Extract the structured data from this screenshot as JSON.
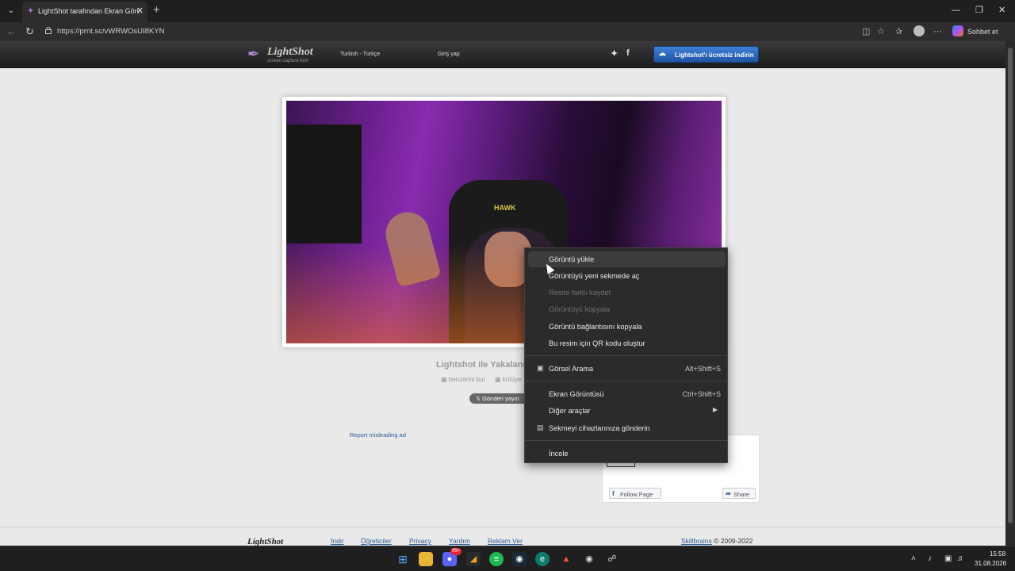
{
  "browser": {
    "tab_title": "LightShot tarafından Ekran Görüntüsü",
    "url": "https://prnt.sc/vWRWOsUI8KYN",
    "copilot_label": "Sohbet et",
    "icons": [
      "tab-list-icon",
      "new-tab-icon",
      "back-icon",
      "refresh-icon",
      "lock-icon",
      "split-screen-icon",
      "favorite-star-icon",
      "favorites-icon",
      "profile-icon",
      "more-icon",
      "copilot-icon",
      "minimize-icon",
      "restore-icon",
      "close-icon"
    ]
  },
  "site": {
    "logo_text": "LightShot",
    "logo_tagline": "screen capture tool",
    "language": "Turkish - Türkçe",
    "login": "Giriş yap",
    "download_button": "Lightshot'ı ücretsiz indirin",
    "photo_badge": "HAWK",
    "caption_title": "Lightshot ile Yakalanm",
    "similar_link": "benzerini bul",
    "report_bad": "kötüye",
    "tweet_button": "Gönderi yayın",
    "report_ad": "Report misleading ad",
    "fb_follow": "Follow Page",
    "fb_share": "Share",
    "footer_logo": "LightShot",
    "footer_links": [
      "İndir",
      "Öğreticiler",
      "Privacy",
      "Yardım",
      "Reklam Ver"
    ],
    "footer_brand": "Skillbrains",
    "footer_copy": "© 2009-2022"
  },
  "context_menu": {
    "items": [
      {
        "label": "Görüntü yükle",
        "state": "hover"
      },
      {
        "label": "Görüntüyü yeni sekmede aç",
        "state": "normal"
      },
      {
        "label": "Resmi farklı kaydet",
        "state": "disabled"
      },
      {
        "label": "Görüntüyü kopyala",
        "state": "disabled"
      },
      {
        "label": "Görüntü bağlantısını kopyala",
        "state": "normal"
      },
      {
        "label": "Bu resim için QR kodu oluştur",
        "state": "normal"
      },
      {
        "label": "Görsel Arama",
        "shortcut": "Alt+Shift+S",
        "icon": "visual-search-icon"
      },
      {
        "label": "Ekran Görüntüsü",
        "shortcut": "Ctrl+Shift+S"
      },
      {
        "label": "Diğer araçlar",
        "submenu": true
      },
      {
        "label": "Sekmeyi cihazlarınıza gönderin",
        "icon": "send-to-device-icon"
      },
      {
        "label": "İncele"
      }
    ]
  },
  "taskbar": {
    "apps": [
      "windows-start-icon",
      "file-explorer-icon",
      "discord-icon",
      "app-icon",
      "spotify-icon",
      "steam-icon",
      "edge-icon",
      "brave-icon",
      "app-icon",
      "app-icon"
    ],
    "discord_badge": "99+",
    "time": "15:58",
    "date": "31.08.2026"
  }
}
